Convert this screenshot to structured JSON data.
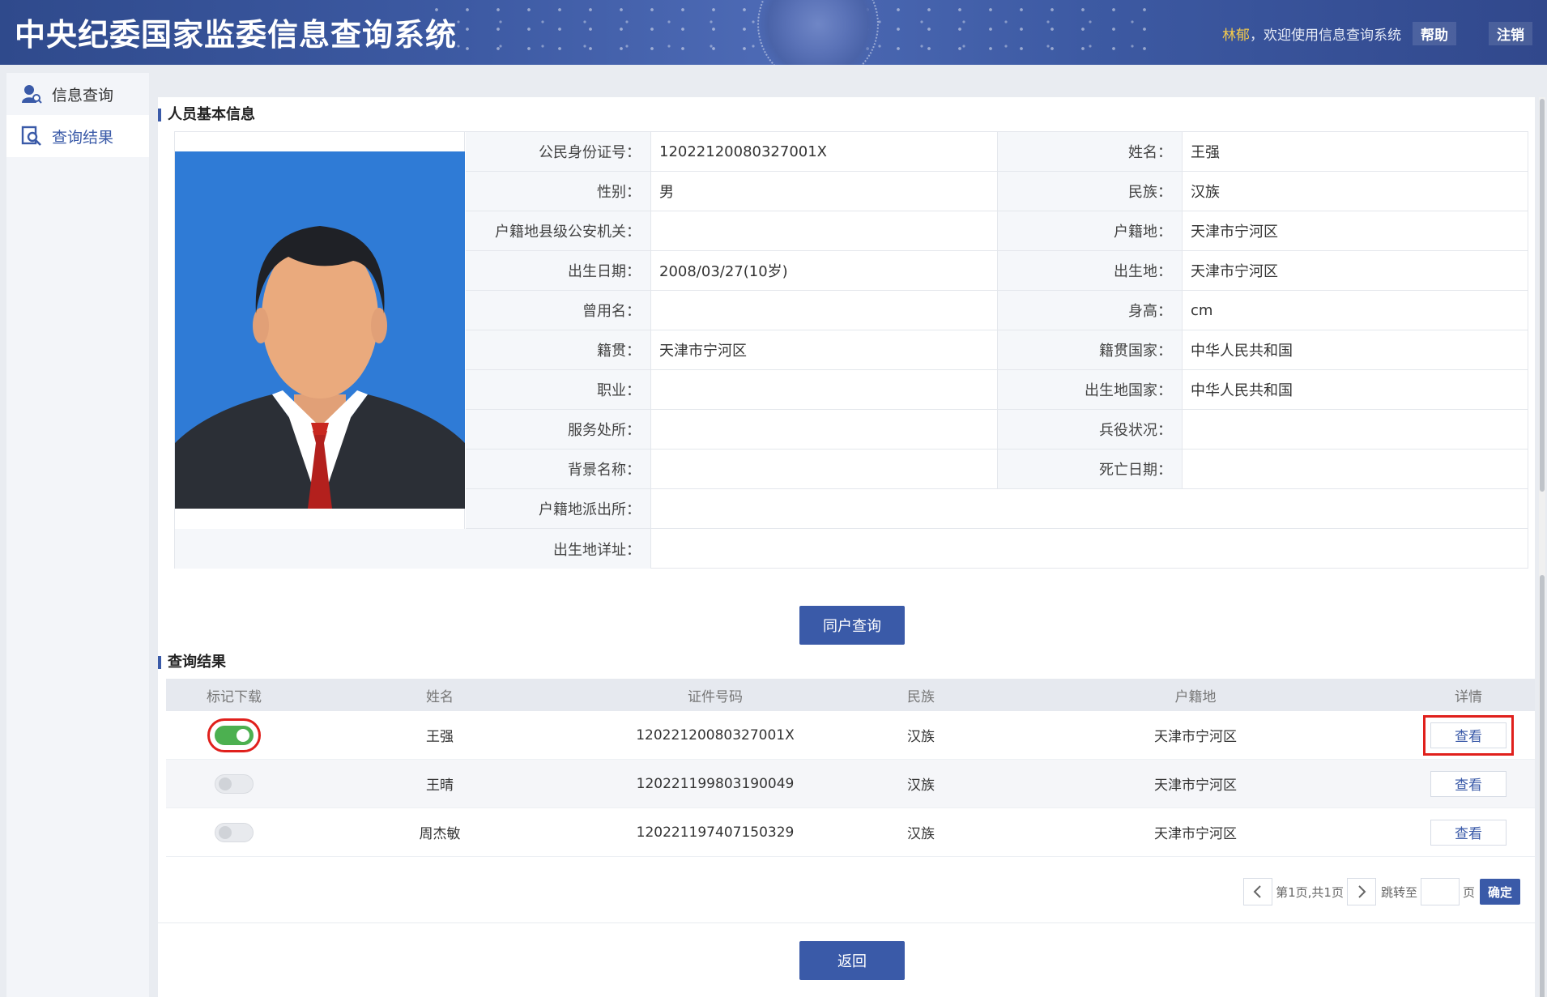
{
  "header": {
    "title": "中央纪委国家监委信息查询系统",
    "user_name": "林郁",
    "welcome": "，欢迎使用信息查询系统",
    "help": "帮助",
    "logout": "注销"
  },
  "sidebar": {
    "items": [
      {
        "label": "信息查询",
        "icon": "user-search-icon",
        "active": false
      },
      {
        "label": "查询结果",
        "icon": "document-search-icon",
        "active": true
      }
    ]
  },
  "basic_info": {
    "title": "人员基本信息",
    "id_label": "公民身份证号：",
    "id_value": "12022120080327001X",
    "name_label": "姓名：",
    "name_value": "王强",
    "gender_label": "性别：",
    "gender_value": "男",
    "ethnicity_label": "民族：",
    "ethnicity_value": "汉族",
    "police_label": "户籍地县级公安机关：",
    "police_value": "",
    "household_label": "户籍地：",
    "household_value": "天津市宁河区",
    "birthdate_label": "出生日期：",
    "birthdate_value": "2008/03/27(10岁)",
    "birthplace_label": "出生地：",
    "birthplace_value": "天津市宁河区",
    "former_name_label": "曾用名：",
    "former_name_value": "",
    "height_label": "身高：",
    "height_value": "cm",
    "native_label": "籍贯：",
    "native_value": "天津市宁河区",
    "native_country_label": "籍贯国家：",
    "native_country_value": "中华人民共和国",
    "occupation_label": "职业：",
    "occupation_value": "",
    "birth_country_label": "出生地国家：",
    "birth_country_value": "中华人民共和国",
    "workplace_label": "服务处所：",
    "workplace_value": "",
    "military_label": "兵役状况：",
    "military_value": "",
    "background_label": "背景名称：",
    "background_value": "",
    "death_label": "死亡日期：",
    "death_value": "",
    "station_label": "户籍地派出所：",
    "station_value": "",
    "birth_detail_label": "出生地详址：",
    "birth_detail_value": ""
  },
  "household_query_button": "同户查询",
  "results": {
    "title": "查询结果",
    "columns": [
      "标记下载",
      "姓名",
      "证件号码",
      "民族",
      "户籍地",
      "详情"
    ],
    "rows": [
      {
        "marked": true,
        "name": "王强",
        "id": "12022120080327001X",
        "ethnicity": "汉族",
        "household": "天津市宁河区",
        "detail": "查看"
      },
      {
        "marked": false,
        "name": "王晴",
        "id": "120221199803190049",
        "ethnicity": "汉族",
        "household": "天津市宁河区",
        "detail": "查看"
      },
      {
        "marked": false,
        "name": "周杰敏",
        "id": "120221197407150329",
        "ethnicity": "汉族",
        "household": "天津市宁河区",
        "detail": "查看"
      }
    ]
  },
  "pager": {
    "page_info": "第1页,共1页",
    "jump_label": "跳转至",
    "page_unit": "页",
    "confirm": "确定"
  },
  "back_button": "返回",
  "colors": {
    "primary": "#3a5aa8",
    "toggle_on": "#4cb050",
    "highlight": "#e0201c",
    "photo_bg": "#2f7bd6"
  }
}
